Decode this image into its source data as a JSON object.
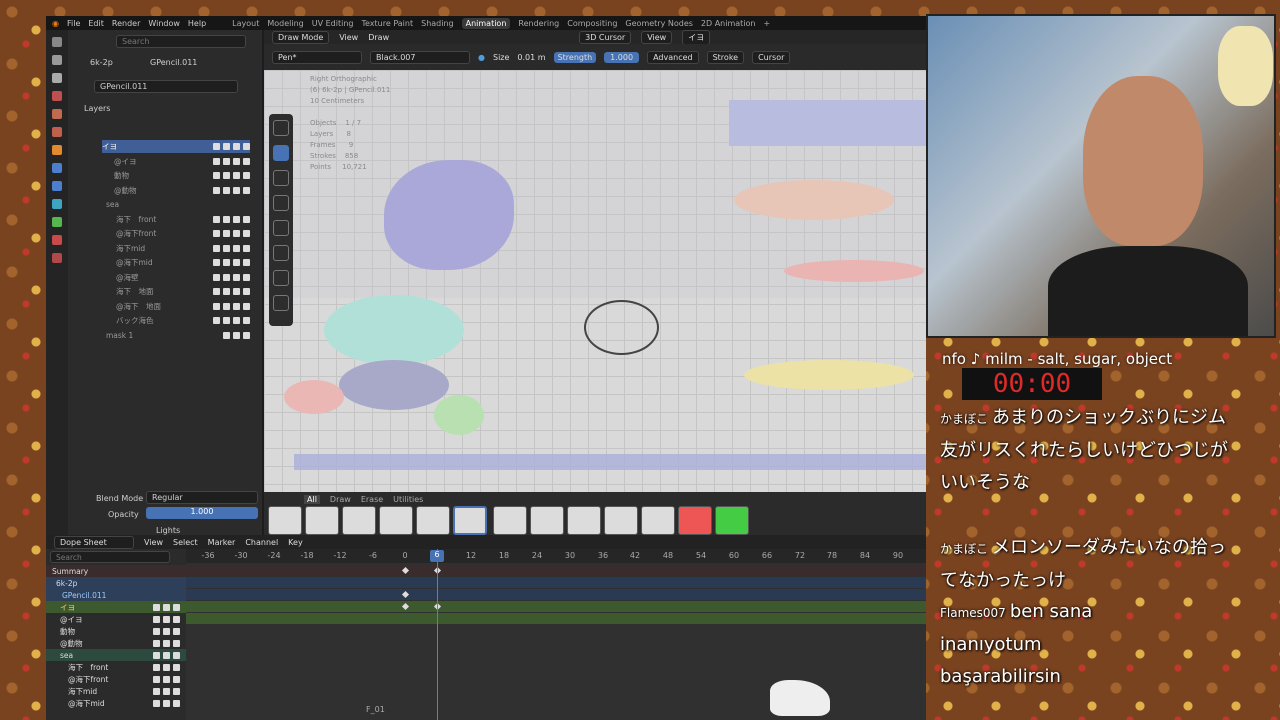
{
  "topbar": {
    "menus": [
      "File",
      "Edit",
      "Render",
      "Window",
      "Help"
    ],
    "workspaces": [
      "Layout",
      "Modeling",
      "UV Editing",
      "Texture Paint",
      "Shading",
      "Animation",
      "Rendering",
      "Compositing",
      "Geometry Nodes",
      "2D Animation",
      "+"
    ],
    "active_workspace": "Animation"
  },
  "properties": {
    "search_placeholder": "Search",
    "scene": "6k-2p",
    "object": "GPencil.011",
    "data_name": "GPencil.011",
    "layers_title": "Layers",
    "layers": [
      "イヨ",
      "@イヨ",
      "動物",
      "@動物",
      "sea",
      "海下　front",
      "@海下front",
      "海下mid",
      "@海下mid",
      "@海壁",
      "海下　地面",
      "@海下　地面",
      "バック海色",
      "mask 1"
    ],
    "blend_mode_label": "Blend Mode",
    "blend_mode": "Regular",
    "opacity_label": "Opacity",
    "opacity": "1.000",
    "lights_label": "Lights"
  },
  "viewport": {
    "mode": "Draw Mode",
    "view": "View",
    "draw": "Draw",
    "cursor": "3D Cursor",
    "view2": "View",
    "layer_sel": "イヨ",
    "brush": "Pen*",
    "material": "Black.007",
    "size_label": "Size",
    "size": "0.01 m",
    "strength_label": "Strength",
    "strength": "1.000",
    "advanced": "Advanced",
    "stroke": "Stroke",
    "cursor2": "Cursor",
    "overlay": "Right Orthographic\n(6) 6k-2p | GPencil.011\n10 Centimeters\n\nObjects    1 / 7\nLayers      8\nFrames      9\nStrokes    858\nPoints     10,721"
  },
  "brushes": {
    "tabs": [
      "All",
      "Draw",
      "Erase",
      "Utilities"
    ],
    "active": "All"
  },
  "dopesheet": {
    "editor": "Dope Sheet",
    "menus": [
      "View",
      "Select",
      "Marker",
      "Channel",
      "Key"
    ],
    "search_placeholder": "Search",
    "ticks": [
      "-36",
      "-30",
      "-24",
      "-18",
      "-12",
      "-6",
      "0",
      "6",
      "12",
      "18",
      "24",
      "30",
      "36",
      "42",
      "48",
      "54",
      "60",
      "66",
      "72",
      "78",
      "84",
      "90"
    ],
    "current_frame": "6",
    "marker": "F_01",
    "channels": [
      "Summary",
      "6k-2p",
      "GPencil.011",
      "イヨ",
      "@イヨ",
      "動物",
      "@動物",
      "sea",
      "海下　front",
      "@海下front",
      "海下mid",
      "@海下mid"
    ]
  },
  "stream": {
    "now_playing": "nfo ♪  milm - salt, sugar, object",
    "timer": "00:00",
    "messages": [
      {
        "name": "かまぼこ",
        "text": "あまりのショックぶりにジム友がリスくれたらしいけどひつじがいいそうな"
      },
      {
        "name": "かまぼこ",
        "text": "メロンソーダみたいなの拾ってなかったっけ"
      },
      {
        "name": "Flames007",
        "text": "ben sana inanıyotum başarabilirsin"
      }
    ]
  },
  "colors": {
    "accent": "#4772b3",
    "keyframe_band": "#3c5a2e",
    "timer_red": "#e02a2a"
  }
}
